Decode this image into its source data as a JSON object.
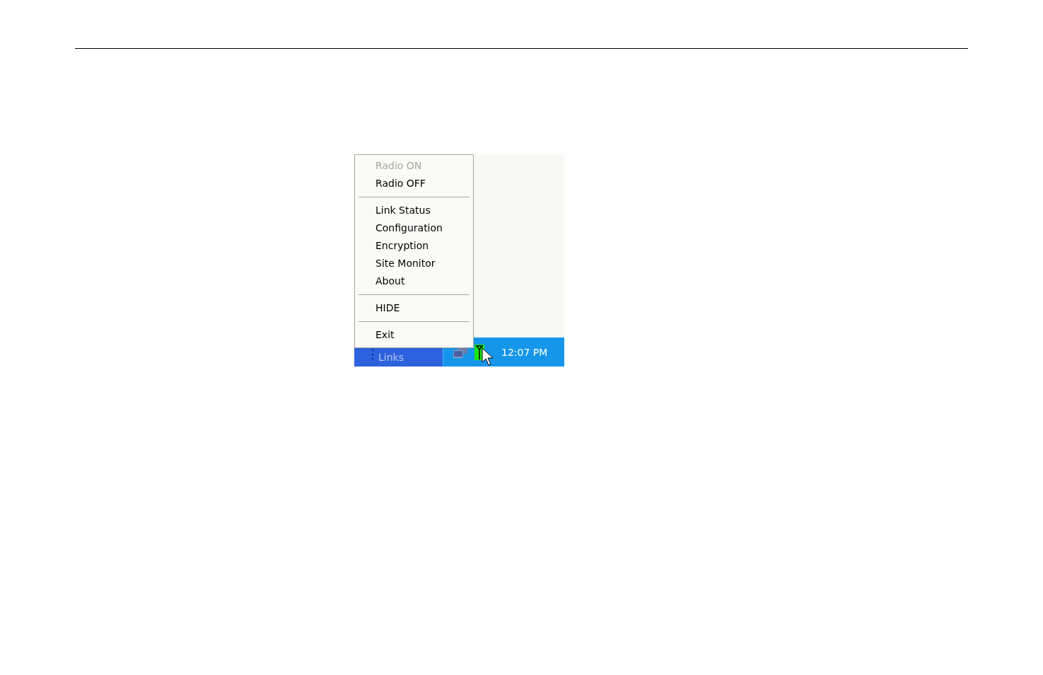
{
  "context_menu": {
    "items": [
      {
        "kind": "item",
        "label": "Radio ON",
        "disabled": true
      },
      {
        "kind": "item",
        "label": "Radio OFF",
        "disabled": false
      },
      {
        "kind": "separator"
      },
      {
        "kind": "item",
        "label": "Link Status",
        "disabled": false
      },
      {
        "kind": "item",
        "label": "Configuration",
        "disabled": false
      },
      {
        "kind": "item",
        "label": "Encryption",
        "disabled": false
      },
      {
        "kind": "item",
        "label": "Site Monitor",
        "disabled": false
      },
      {
        "kind": "item",
        "label": "About",
        "disabled": false
      },
      {
        "kind": "separator"
      },
      {
        "kind": "item",
        "label": "HIDE",
        "disabled": false
      },
      {
        "kind": "separator"
      },
      {
        "kind": "item",
        "label": "Exit",
        "disabled": false
      }
    ]
  },
  "taskbar": {
    "links_toolbar": {
      "label": "Links"
    },
    "clock": "12:07 PM"
  }
}
